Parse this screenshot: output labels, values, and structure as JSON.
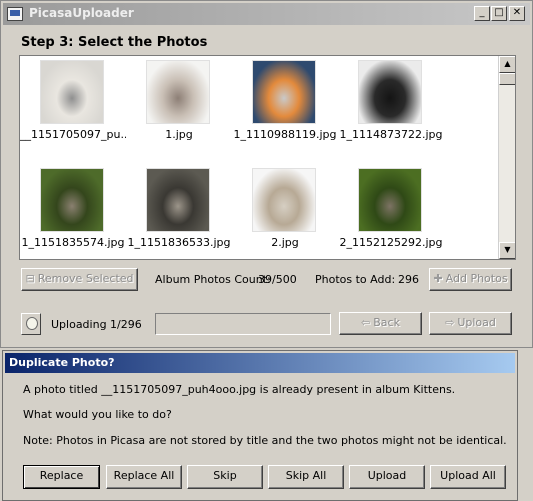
{
  "window": {
    "title": "PicasaUploader",
    "controls": {
      "minimize": "_",
      "maximize": "□",
      "close": "✕"
    }
  },
  "step_title": "Step 3: Select the Photos",
  "photos": [
    {
      "name": "__1151705097_pu...",
      "colors": [
        "#d9d7d2",
        "#8f8f8f",
        "#e9e6e0"
      ]
    },
    {
      "name": "1.jpg",
      "colors": [
        "#f4f4f2",
        "#8d7f76",
        "#c9bfb5"
      ]
    },
    {
      "name": "1_1110988119.jpg",
      "colors": [
        "#2e4a6f",
        "#c9c9c9",
        "#e38a3c"
      ]
    },
    {
      "name": "1_1114873722.jpg",
      "colors": [
        "#ebebeb",
        "#141414",
        "#2a2a2a"
      ]
    },
    {
      "name": "1_1151835574.jpg",
      "colors": [
        "#4e6b2a",
        "#8a8070",
        "#34461c"
      ]
    },
    {
      "name": "1_1151836533.jpg",
      "colors": [
        "#5c5a52",
        "#9c958a",
        "#3a3833"
      ]
    },
    {
      "name": "2.jpg",
      "colors": [
        "#f6f6f6",
        "#d6cfc3",
        "#b7a995"
      ]
    },
    {
      "name": "2_1152125292.jpg",
      "colors": [
        "#4c6e22",
        "#7d7364",
        "#2f4916"
      ]
    }
  ],
  "toolbar": {
    "remove_selected": "Remove Selected",
    "album_count_label": "Album Photos Count:",
    "album_count_value": "39/500",
    "photos_to_add_label": "Photos to Add:",
    "photos_to_add_value": "296",
    "add_photos": "Add Photos"
  },
  "status": {
    "uploading": "Uploading 1/296",
    "back": "Back",
    "upload": "Upload",
    "progress": 0
  },
  "dialog": {
    "title": "Duplicate Photo?",
    "message": "A photo titled __1151705097_puh4ooo.jpg is already present in album Kittens.",
    "question": "What would you like to do?",
    "note": "Note: Photos in Picasa are not stored by title and the two photos might not be identical.",
    "buttons": {
      "replace": "Replace",
      "replace_all": "Replace All",
      "skip": "Skip",
      "skip_all": "Skip All",
      "upload": "Upload",
      "upload_all": "Upload All"
    }
  }
}
